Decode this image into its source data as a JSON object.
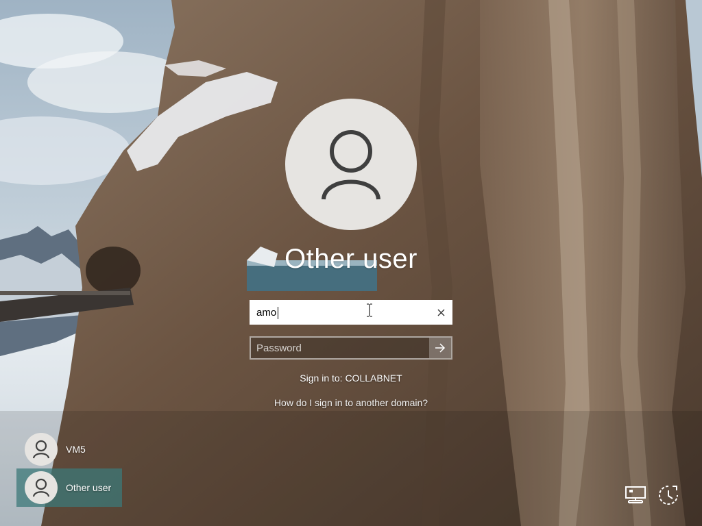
{
  "login": {
    "user_title": "Other user",
    "username_value": "amo",
    "password_placeholder": "Password",
    "sign_in_to": "Sign in to: COLLABNET",
    "domain_help_link": "How do I sign in to another domain?",
    "icons": {
      "avatar": "person-icon",
      "clear": "close-icon",
      "submit": "arrow-right-icon"
    }
  },
  "user_list": [
    {
      "label": "VM5",
      "icon": "person-icon",
      "selected": false
    },
    {
      "label": "Other user",
      "icon": "person-icon",
      "selected": true
    }
  ],
  "corner_controls": {
    "network": "network-icon",
    "accessibility": "ease-of-access-icon"
  },
  "colors": {
    "selected_tile": "#3c7878",
    "avatar_fill": "#e6e4e1",
    "text": "#ffffff"
  }
}
